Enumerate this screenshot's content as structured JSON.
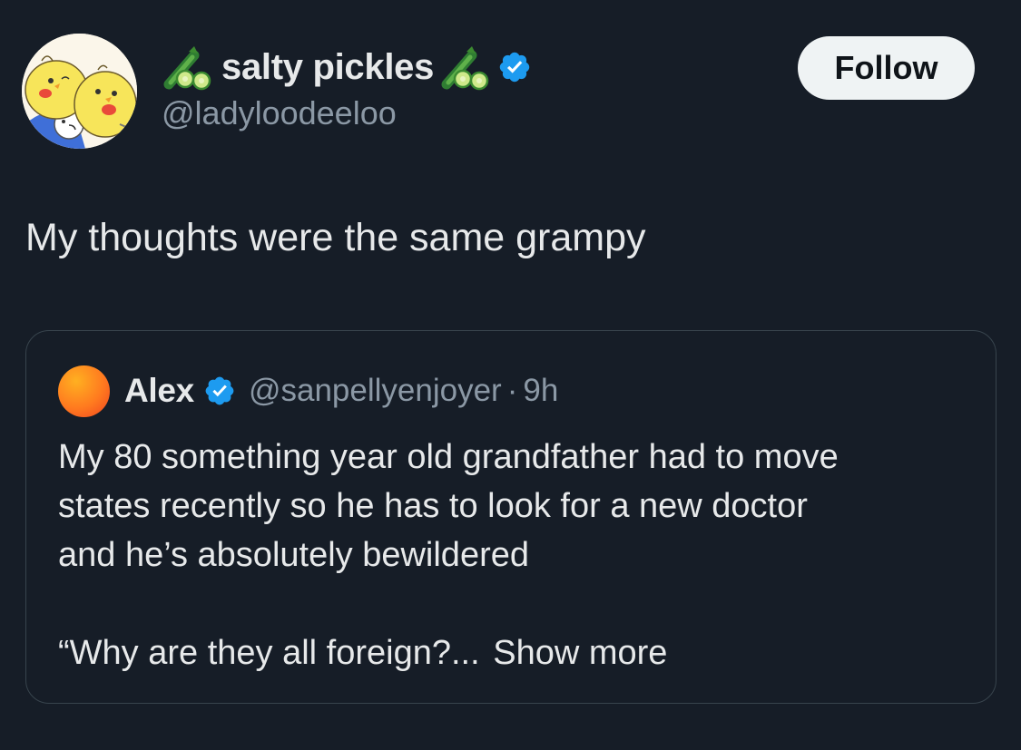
{
  "author": {
    "display_name": "salty pickles",
    "handle": "@ladyloodeeloo",
    "name_prefix_icon": "cucumber-icon",
    "name_suffix_icon": "cucumber-icon",
    "verified": true,
    "verified_color": "#1d9bf0"
  },
  "follow_button": {
    "label": "Follow"
  },
  "tweet": {
    "text": "My thoughts were the same grampy"
  },
  "quoted_tweet": {
    "author_name": "Alex",
    "author_handle": "@sanpellyenjoyer",
    "separator": "·",
    "time": "9h",
    "verified": true,
    "body_lines": [
      "My 80 something year old grandfather had to move",
      "states recently so he has to look for a new doctor",
      "and he’s absolutely bewildered"
    ],
    "truncated_line": "“Why are they all foreign?...",
    "show_more_label": "Show more"
  },
  "colors": {
    "background": "#161d27",
    "text_primary": "#e7e9ea",
    "text_secondary": "#8b98a5",
    "border": "#38444d",
    "button_bg": "#eff3f4"
  }
}
